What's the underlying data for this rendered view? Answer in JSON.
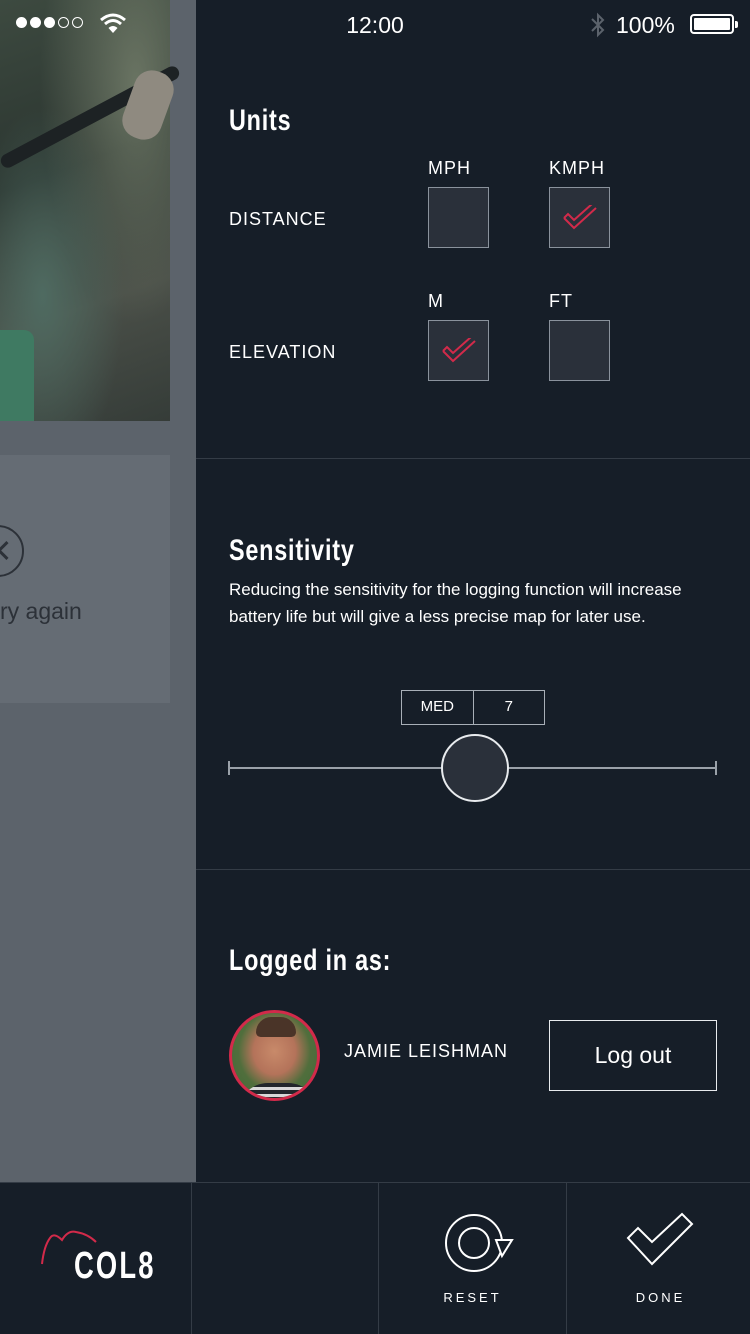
{
  "status_bar": {
    "time": "12:00",
    "battery": "100%",
    "signal_bars_filled": 3,
    "signal_bars_total": 5
  },
  "background_page": {
    "error_text": "ry again"
  },
  "units": {
    "title": "Units",
    "rows": [
      {
        "label": "DISTANCE",
        "options": [
          {
            "label": "MPH",
            "checked": false
          },
          {
            "label": "KMPH",
            "checked": true
          }
        ]
      },
      {
        "label": "ELEVATION",
        "options": [
          {
            "label": "M",
            "checked": true
          },
          {
            "label": "FT",
            "checked": false
          }
        ]
      }
    ]
  },
  "sensitivity": {
    "title": "Sensitivity",
    "description": "Reducing the sensitivity for the logging function will increase battery life but will give a less precise map for later use.",
    "level_label": "MED",
    "level_value": "7",
    "slider_fraction": 0.5
  },
  "account": {
    "title": "Logged in as:",
    "user_name": "JAMIE LEISHMAN",
    "logout_label": "Log out"
  },
  "toolbar": {
    "logo_text": "COL8",
    "reset_label": "RESET",
    "done_label": "DONE"
  },
  "colors": {
    "background": "#161e28",
    "accent": "#d22a4a",
    "checkbox_fill": "#2a303a"
  },
  "icons": {
    "signal": "signal-dots-icon",
    "wifi": "wifi-icon",
    "bluetooth": "bluetooth-icon",
    "battery": "battery-icon",
    "checkmark": "checkmark-icon",
    "reset": "reset-icon",
    "done": "done-check-icon",
    "error": "error-x-icon",
    "logo": "col8-logo-icon"
  }
}
